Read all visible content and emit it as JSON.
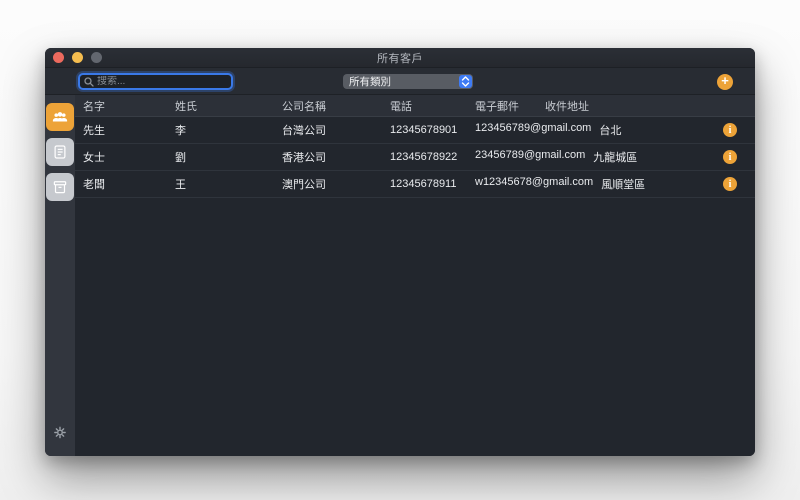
{
  "window": {
    "title": "所有客戶"
  },
  "toolbar": {
    "search_placeholder": "搜索...",
    "category_selected": "所有類別",
    "add_button_glyph": "+"
  },
  "sidebar": {
    "items": [
      {
        "id": "customers",
        "icon": "people-icon",
        "selected": true
      },
      {
        "id": "invoices",
        "icon": "document-list-icon",
        "selected": false
      },
      {
        "id": "archive",
        "icon": "box-icon",
        "selected": false
      }
    ],
    "footer_icon": "gear-icon"
  },
  "table": {
    "headers": [
      "名字",
      "姓氏",
      "公司名稱",
      "電話",
      "電子郵件",
      "收件地址"
    ],
    "info_glyph": "i",
    "rows": [
      {
        "first": "先生",
        "last": "李",
        "company": "台灣公司",
        "phone": "12345678901",
        "email": "123456789@gmail.com",
        "address": "台北"
      },
      {
        "first": "女士",
        "last": "劉",
        "company": "香港公司",
        "phone": "12345678922",
        "email": "23456789@gmail.com",
        "address": "九龍城區"
      },
      {
        "first": "老闆",
        "last": "王",
        "company": "澳門公司",
        "phone": "12345678911",
        "email": "w12345678@gmail.com",
        "address": "風順堂區"
      }
    ]
  },
  "colors": {
    "accent_orange": "#eda338",
    "focus_blue": "#3a79e8",
    "popup_blue": "#3e7bf5",
    "window_bg": "#22262d",
    "sidebar_bg": "#32363e",
    "header_bg": "#2c3038"
  }
}
